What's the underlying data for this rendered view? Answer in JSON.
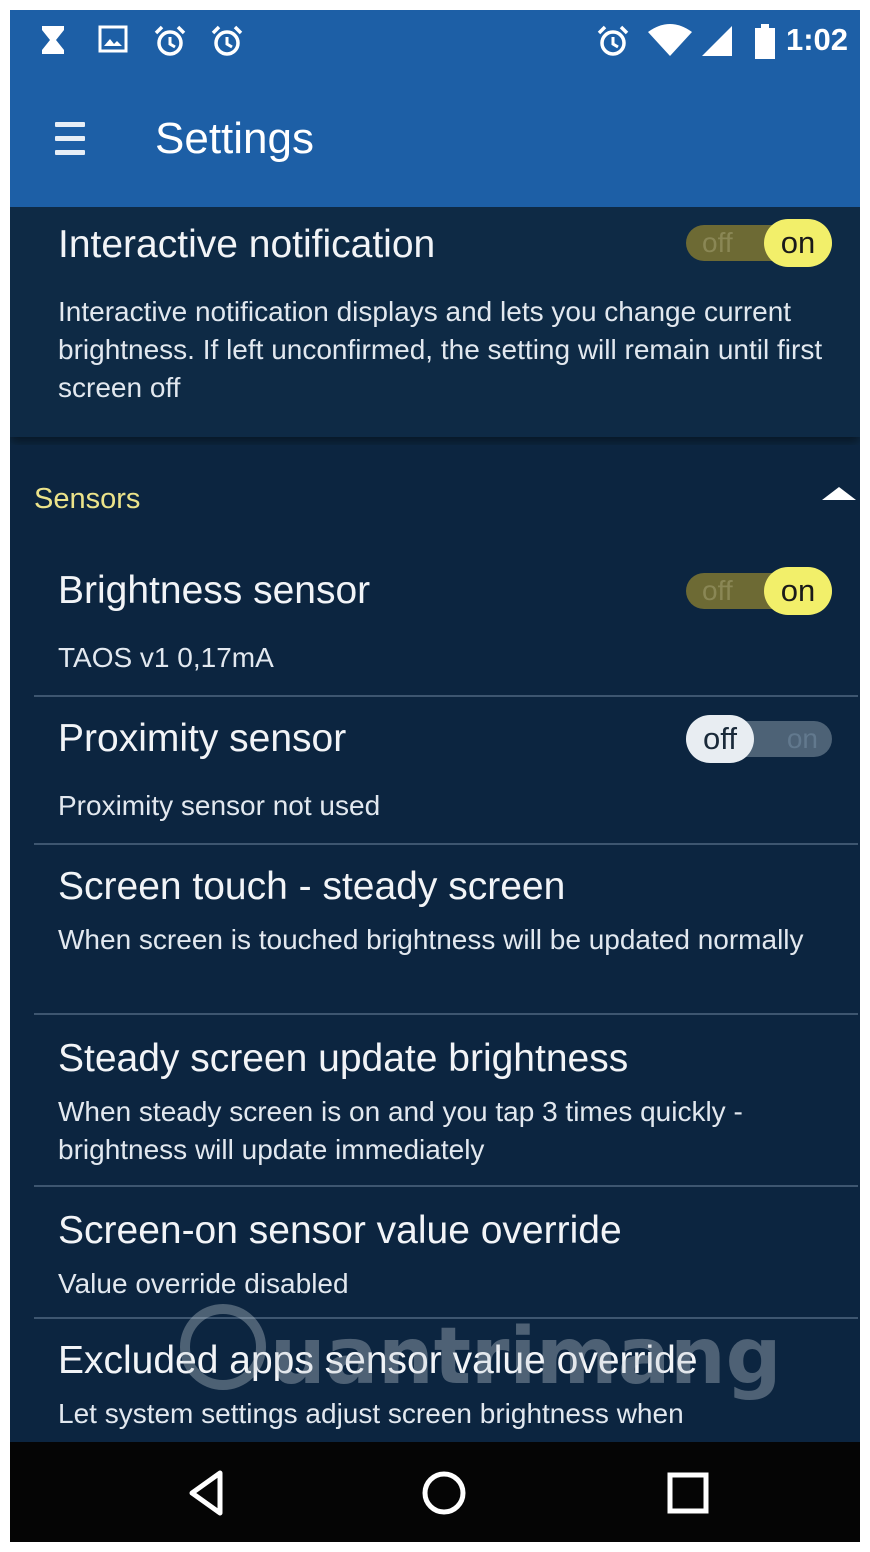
{
  "status_bar": {
    "left_icons": [
      "hourglass-icon",
      "image-icon",
      "alarm-icon",
      "alarm-icon"
    ],
    "right_icons": [
      "alarm-icon",
      "wifi-icon",
      "signal-icon",
      "battery-icon"
    ],
    "time": "1:02"
  },
  "app_bar": {
    "title": "Settings",
    "menu_icon": "hamburger-menu-icon"
  },
  "interactive_notification": {
    "title": "Interactive notification",
    "description": "Interactive notification displays and lets you change current brightness. If left unconfirmed, the setting will remain until first screen off",
    "toggle": {
      "state": "on",
      "on_label": "on",
      "off_label": "off"
    }
  },
  "sensors_section": {
    "title": "Sensors",
    "collapse_icon": "collapse-up-icon",
    "items": [
      {
        "title": "Brightness sensor",
        "description": "TAOS v1 0,17mA",
        "toggle": {
          "state": "on",
          "on_label": "on",
          "off_label": "off"
        }
      },
      {
        "title": "Proximity sensor",
        "description": "Proximity sensor not used",
        "toggle": {
          "state": "off",
          "on_label": "on",
          "off_label": "off"
        }
      },
      {
        "title": "Screen touch - steady screen",
        "description": "When screen is touched brightness will be updated normally"
      },
      {
        "title": "Steady screen update brightness",
        "description": "When steady screen is on and you tap 3 times quickly - brightness will update immediately"
      },
      {
        "title": "Screen-on sensor value override",
        "description": "Value override disabled"
      },
      {
        "title": "Excluded apps sensor value override",
        "description": "Let system settings adjust screen brightness when"
      }
    ]
  },
  "nav_bar": {
    "back_icon": "back-icon",
    "home_icon": "home-icon",
    "recents_icon": "recents-icon"
  },
  "watermark": {
    "text": "uantrimang"
  },
  "colors": {
    "app_bar": "#1d5fa6",
    "background": "#0e2a45",
    "section_accent": "#ece38a",
    "toggle_on": "#f2ef6a"
  }
}
